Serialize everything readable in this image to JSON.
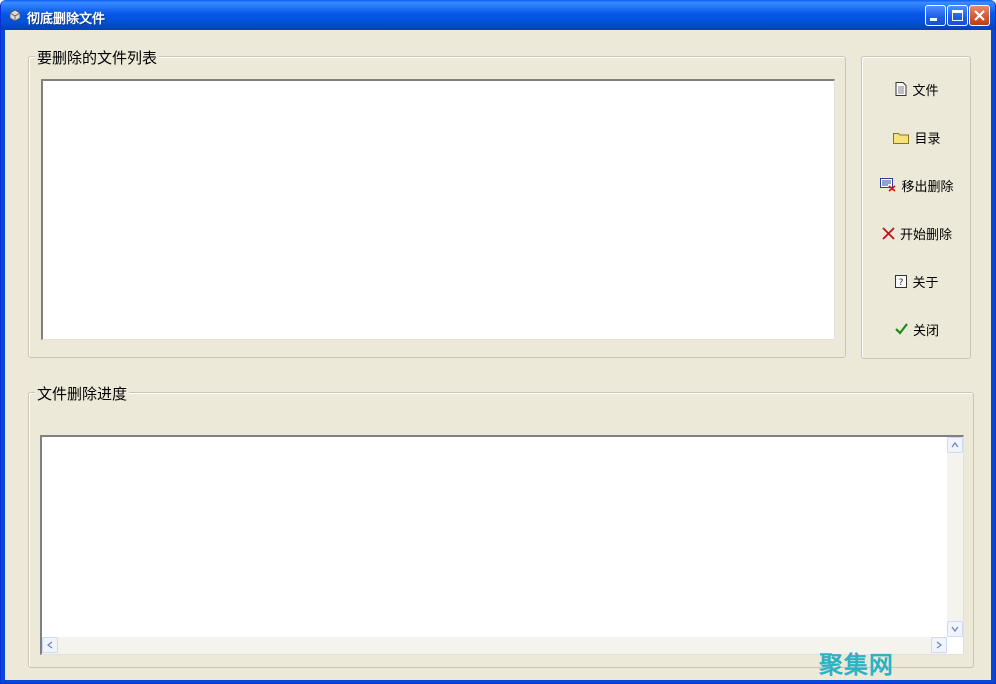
{
  "window": {
    "title": "彻底删除文件"
  },
  "file_list_group": {
    "label": "要删除的文件列表"
  },
  "progress_group": {
    "label": "文件删除进度"
  },
  "side_buttons": [
    {
      "label": "文件",
      "icon": "document-icon"
    },
    {
      "label": "目录",
      "icon": "folder-icon"
    },
    {
      "label": "移出删除",
      "icon": "remove-from-list-icon"
    },
    {
      "label": "开始删除",
      "icon": "red-x-icon"
    },
    {
      "label": "关于",
      "icon": "help-icon"
    },
    {
      "label": "关闭",
      "icon": "checkmark-icon"
    }
  ],
  "watermark": {
    "text": "聚集网"
  },
  "colors": {
    "titlebar": "#0758e8",
    "client": "#ece9d8",
    "close_button": "#d2572f",
    "watermark": "#2fb1c4"
  }
}
